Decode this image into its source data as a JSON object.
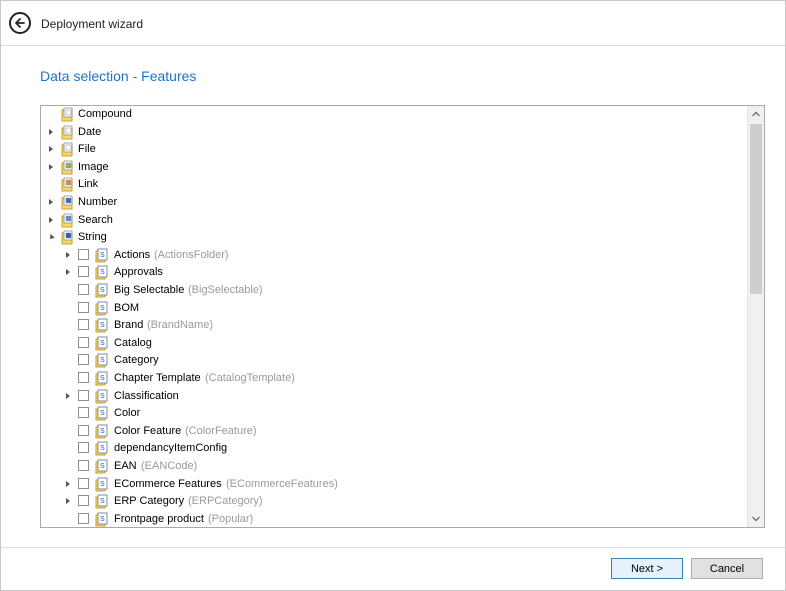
{
  "header": {
    "title": "Deployment wizard",
    "back_icon": "back-arrow-icon"
  },
  "section": {
    "title": "Data selection - Features"
  },
  "tree": {
    "roots": [
      {
        "label": "Compound",
        "expander": "none",
        "icon": "compound-doc-icon"
      },
      {
        "label": "Date",
        "expander": "collapsed",
        "icon": "date-icon"
      },
      {
        "label": "File",
        "expander": "collapsed",
        "icon": "file-icon"
      },
      {
        "label": "Image",
        "expander": "collapsed",
        "icon": "image-icon"
      },
      {
        "label": "Link",
        "expander": "none",
        "icon": "link-icon"
      },
      {
        "label": "Number",
        "expander": "collapsed",
        "icon": "number-icon"
      },
      {
        "label": "Search",
        "expander": "collapsed",
        "icon": "search-icon"
      },
      {
        "label": "String",
        "expander": "expanded",
        "icon": "string-icon"
      }
    ],
    "string_children": [
      {
        "label": "Actions",
        "sub": "(ActionsFolder)",
        "expander": "collapsed"
      },
      {
        "label": "Approvals",
        "sub": "",
        "expander": "collapsed"
      },
      {
        "label": "Big Selectable",
        "sub": "(BigSelectable)",
        "expander": "none"
      },
      {
        "label": "BOM",
        "sub": "",
        "expander": "none"
      },
      {
        "label": "Brand",
        "sub": "(BrandName)",
        "expander": "none"
      },
      {
        "label": "Catalog",
        "sub": "",
        "expander": "none"
      },
      {
        "label": "Category",
        "sub": "",
        "expander": "none"
      },
      {
        "label": "Chapter Template",
        "sub": "(CatalogTemplate)",
        "expander": "none"
      },
      {
        "label": "Classification",
        "sub": "",
        "expander": "collapsed"
      },
      {
        "label": "Color",
        "sub": "",
        "expander": "none"
      },
      {
        "label": "Color Feature",
        "sub": "(ColorFeature)",
        "expander": "none"
      },
      {
        "label": "dependancyItemConfig",
        "sub": "",
        "expander": "none"
      },
      {
        "label": "EAN",
        "sub": "(EANCode)",
        "expander": "none"
      },
      {
        "label": "ECommerce Features",
        "sub": "(ECommerceFeatures)",
        "expander": "collapsed"
      },
      {
        "label": "ERP Category",
        "sub": "(ERPCategory)",
        "expander": "collapsed"
      },
      {
        "label": "Frontpage product",
        "sub": "(Popular)",
        "expander": "none"
      }
    ]
  },
  "buttons": {
    "next": "Next >",
    "cancel": "Cancel"
  },
  "colors": {
    "accent": "#1e73c0"
  }
}
